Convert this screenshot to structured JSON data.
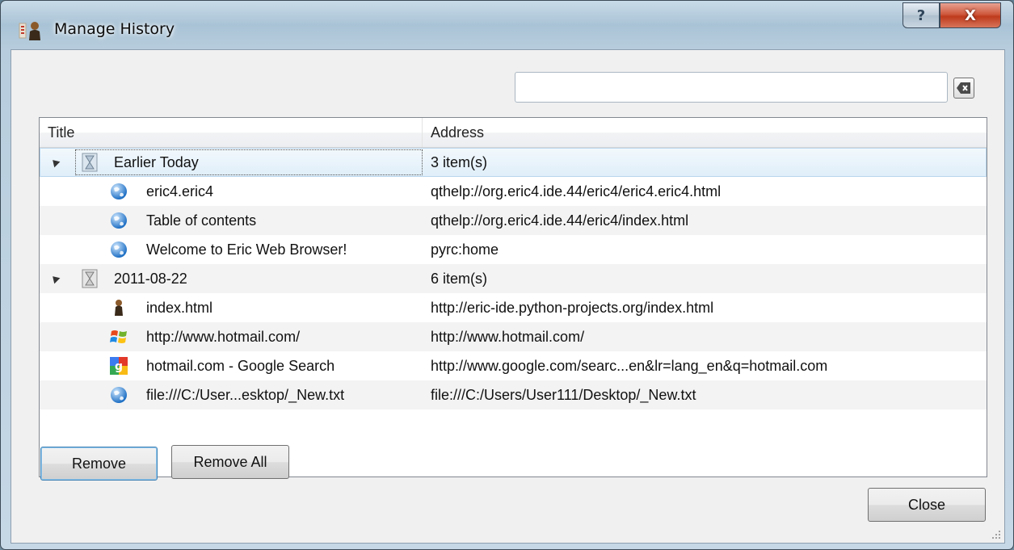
{
  "window": {
    "title": "Manage History",
    "help_glyph": "?",
    "close_glyph": "X"
  },
  "search": {
    "value": "",
    "placeholder": ""
  },
  "tree": {
    "columns": [
      "Title",
      "Address"
    ],
    "groups": [
      {
        "label": "Earlier Today",
        "count": "3 item(s)",
        "items": [
          {
            "title": "eric4.eric4",
            "address": "qthelp://org.eric4.ide.44/eric4/eric4.eric4.html",
            "icon": "globe-icon"
          },
          {
            "title": "Table of contents",
            "address": "qthelp://org.eric4.ide.44/eric4/index.html",
            "icon": "globe-icon"
          },
          {
            "title": "Welcome to Eric Web Browser!",
            "address": "pyrc:home",
            "icon": "globe-icon"
          }
        ]
      },
      {
        "label": "2011-08-22",
        "count": "6 item(s)",
        "items": [
          {
            "title": "index.html",
            "address": "http://eric-ide.python-projects.org/index.html",
            "icon": "eric-icon"
          },
          {
            "title": "http://www.hotmail.com/",
            "address": "http://www.hotmail.com/",
            "icon": "windows-icon"
          },
          {
            "title": "hotmail.com - Google Search",
            "address": "http://www.google.com/searc...en&lr=lang_en&q=hotmail.com",
            "icon": "google-icon"
          },
          {
            "title": "file:///C:/User...esktop/_New.txt",
            "address": "file:///C:/Users/User111/Desktop/_New.txt",
            "icon": "globe-icon"
          }
        ]
      }
    ]
  },
  "buttons": {
    "remove": "Remove",
    "remove_all": "Remove All",
    "close": "Close"
  }
}
